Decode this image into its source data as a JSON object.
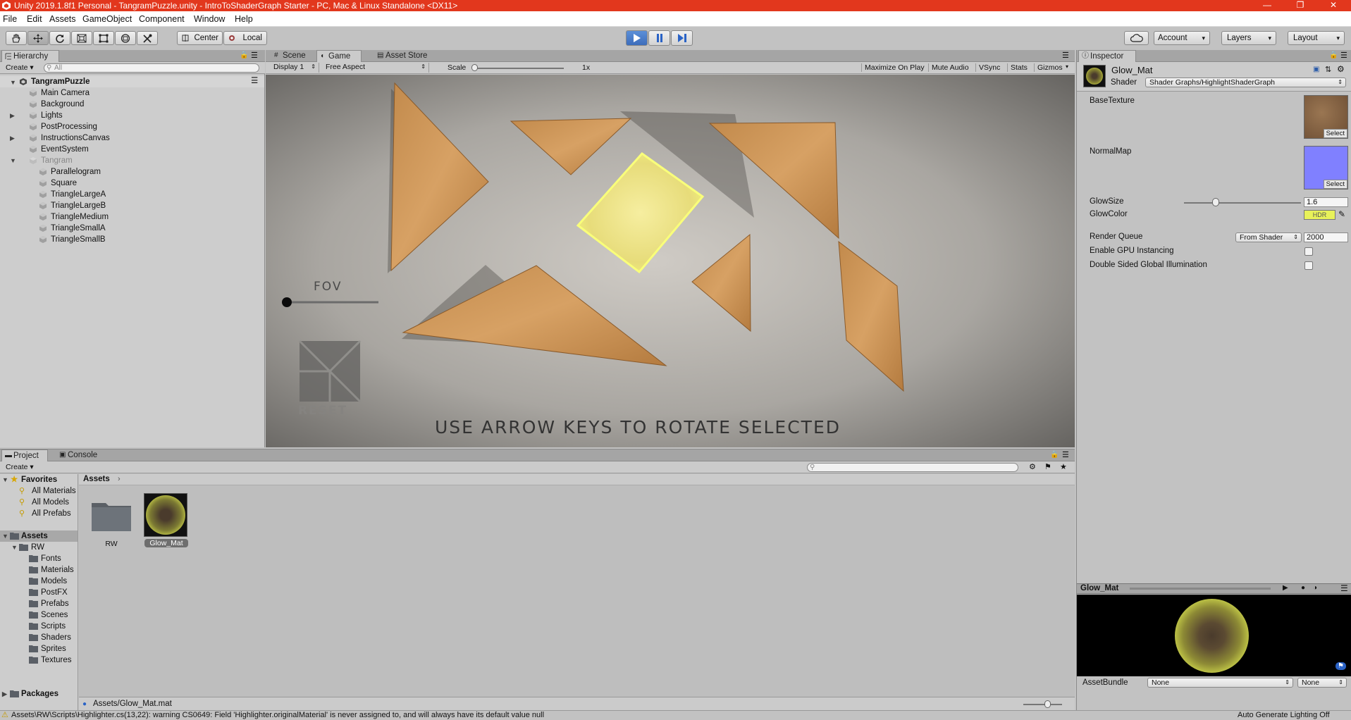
{
  "window": {
    "title": "Unity 2019.1.8f1 Personal - TangramPuzzle.unity - IntroToShaderGraph Starter - PC, Mac & Linux Standalone <DX11>"
  },
  "menu": [
    "File",
    "Edit",
    "Assets",
    "GameObject",
    "Component",
    "Window",
    "Help"
  ],
  "toolbar": {
    "pivot": "Center",
    "space": "Local",
    "account": "Account",
    "layers": "Layers",
    "layout": "Layout"
  },
  "hierarchy": {
    "tab": "Hierarchy",
    "create": "Create",
    "search_placeholder": "All",
    "scene": "TangramPuzzle",
    "items": [
      {
        "label": "Main Camera"
      },
      {
        "label": "Background"
      },
      {
        "label": "Lights"
      },
      {
        "label": "PostProcessing"
      },
      {
        "label": "InstructionsCanvas"
      },
      {
        "label": "EventSystem"
      },
      {
        "label": "Tangram"
      },
      {
        "label": "Parallelogram"
      },
      {
        "label": "Square"
      },
      {
        "label": "TriangleLargeA"
      },
      {
        "label": "TriangleLargeB"
      },
      {
        "label": "TriangleMedium"
      },
      {
        "label": "TriangleSmallA"
      },
      {
        "label": "TriangleSmallB"
      }
    ]
  },
  "center_tabs": [
    "Scene",
    "Game",
    "Asset Store"
  ],
  "game_bar": {
    "display": "Display 1",
    "aspect": "Free Aspect",
    "scale_label": "Scale",
    "scale_value": "1x",
    "maximize": "Maximize On Play",
    "mute": "Mute Audio",
    "vsync": "VSync",
    "stats": "Stats",
    "gizmos": "Gizmos"
  },
  "game_view": {
    "fov_label": "FOV",
    "reset_label": "RESET",
    "instructions": "USE ARROW KEYS TO ROTATE SELECTED"
  },
  "inspector": {
    "tab": "Inspector",
    "material_name": "Glow_Mat",
    "shader_label": "Shader",
    "shader_value": "Shader Graphs/HighlightShaderGraph",
    "props": {
      "base_texture": "BaseTexture",
      "normal_map": "NormalMap",
      "select": "Select",
      "glow_size_label": "GlowSize",
      "glow_size_value": "1.6",
      "glow_size_fraction": 0.27,
      "glow_color_label": "GlowColor",
      "hdr": "HDR",
      "render_queue_label": "Render Queue",
      "render_queue_mode": "From Shader",
      "render_queue_value": "2000",
      "gpu_instancing": "Enable GPU Instancing",
      "double_sided": "Double Sided Global Illumination"
    },
    "preview_title": "Glow_Mat",
    "asset_bundle_label": "AssetBundle",
    "asset_bundle_value": "None",
    "asset_bundle_variant": "None"
  },
  "bottom_tabs": [
    "Project",
    "Console"
  ],
  "project": {
    "create": "Create",
    "favorites": {
      "label": "Favorites",
      "items": [
        "All Materials",
        "All Models",
        "All Prefabs"
      ]
    },
    "assets_label": "Assets",
    "rw_label": "RW",
    "rw_children": [
      "Fonts",
      "Materials",
      "Models",
      "PostFX",
      "Prefabs",
      "Scenes",
      "Scripts",
      "Shaders",
      "Sprites",
      "Textures"
    ],
    "packages_label": "Packages",
    "breadcrumb": "Assets",
    "assets": [
      {
        "label": "RW"
      },
      {
        "label": "Glow_Mat"
      }
    ],
    "selected_path": "Assets/Glow_Mat.mat"
  },
  "status": {
    "message": "Assets\\RW\\Scripts\\Highlighter.cs(13,22): warning CS0649: Field 'Highlighter.originalMaterial' is never assigned to, and will always have its default value null",
    "lighting": "Auto Generate Lighting Off"
  },
  "colors": {
    "titlebar": "#e2371d",
    "glow": "#e8f25a",
    "normal_map": "#8080ff",
    "play_active": "#5b8fd8"
  }
}
